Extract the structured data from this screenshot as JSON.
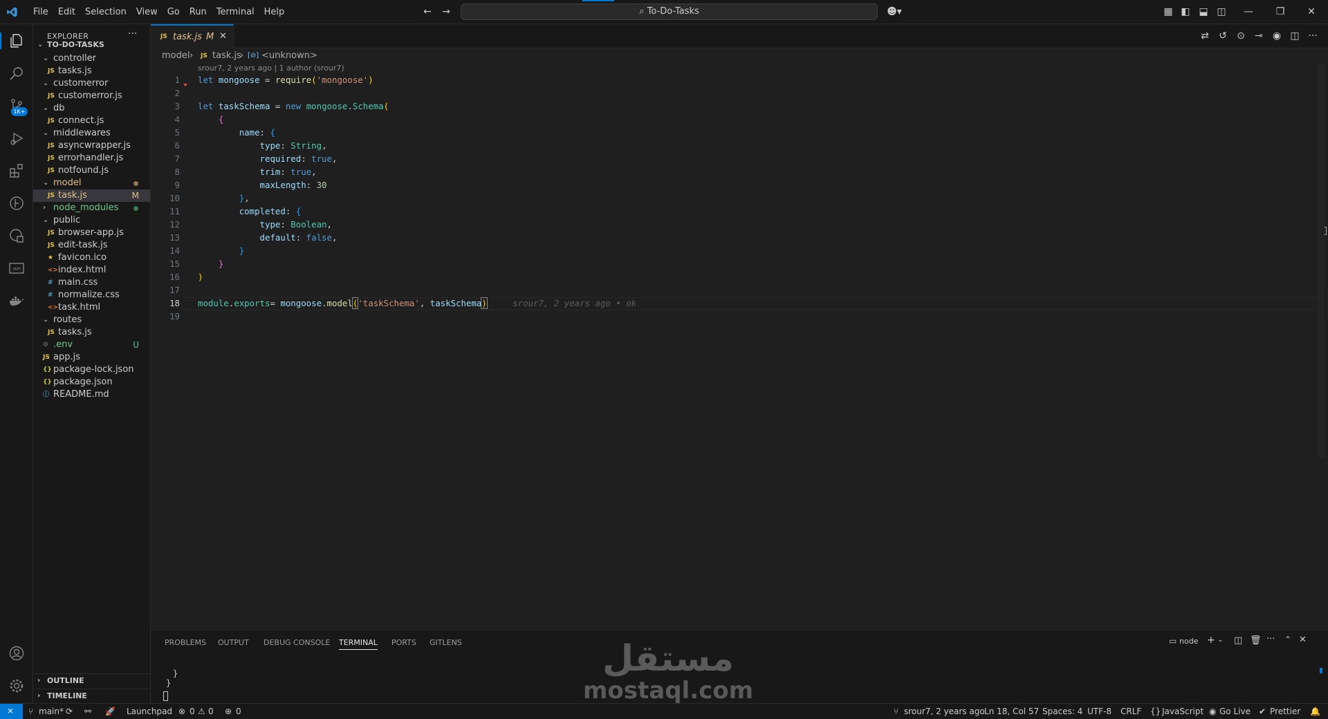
{
  "menu": [
    "File",
    "Edit",
    "Selection",
    "View",
    "Go",
    "Run",
    "Terminal",
    "Help"
  ],
  "search": {
    "text": "To-Do-Tasks"
  },
  "sidebar": {
    "title": "EXPLORER",
    "root": "TO-DO-TASKS",
    "items": [
      {
        "label": "controller",
        "type": "folder"
      },
      {
        "label": "tasks.js",
        "type": "js"
      },
      {
        "label": "customerror",
        "type": "folder"
      },
      {
        "label": "customerror.js",
        "type": "js"
      },
      {
        "label": "db",
        "type": "folder"
      },
      {
        "label": "connect.js",
        "type": "js"
      },
      {
        "label": "middlewares",
        "type": "folder"
      },
      {
        "label": "asyncwrapper.js",
        "type": "js"
      },
      {
        "label": "errorhandler.js",
        "type": "js"
      },
      {
        "label": "notfound.js",
        "type": "js"
      },
      {
        "label": "model",
        "type": "folder"
      },
      {
        "label": "task.js",
        "type": "js",
        "badge": "M"
      },
      {
        "label": "node_modules",
        "type": "folder-closed"
      },
      {
        "label": "public",
        "type": "folder"
      },
      {
        "label": "browser-app.js",
        "type": "js"
      },
      {
        "label": "edit-task.js",
        "type": "js"
      },
      {
        "label": "favicon.ico",
        "type": "ico"
      },
      {
        "label": "index.html",
        "type": "html"
      },
      {
        "label": "main.css",
        "type": "css"
      },
      {
        "label": "normalize.css",
        "type": "css"
      },
      {
        "label": "task.html",
        "type": "html"
      },
      {
        "label": "routes",
        "type": "folder"
      },
      {
        "label": "tasks.js",
        "type": "js"
      },
      {
        "label": ".env",
        "type": "env",
        "badge": "U"
      },
      {
        "label": "app.js",
        "type": "js"
      },
      {
        "label": "package-lock.json",
        "type": "json"
      },
      {
        "label": "package.json",
        "type": "json"
      },
      {
        "label": "README.md",
        "type": "md"
      }
    ],
    "outline": "OUTLINE",
    "timeline": "TIMELINE",
    "source_control_badge": "1K+"
  },
  "tab": {
    "icon": "JS",
    "name": "task.js",
    "modified": "M"
  },
  "breadcrumb": {
    "folder": "model",
    "file": "task.js",
    "symbol": "<unknown>"
  },
  "blame_header": "srour7, 2 years ago | 1 author (srour7)",
  "inline_blame": "srour7, 2 years ago • ok",
  "code_lines": [
    "1",
    "2",
    "3",
    "4",
    "5",
    "6",
    "7",
    "8",
    "9",
    "10",
    "11",
    "12",
    "13",
    "14",
    "15",
    "16",
    "17",
    "18",
    "19"
  ],
  "panel": {
    "tabs": [
      "PROBLEMS",
      "OUTPUT",
      "DEBUG CONSOLE",
      "TERMINAL",
      "PORTS",
      "GITLENS"
    ],
    "terminal_name": "node",
    "terminal_lines": [
      "}",
      "}"
    ]
  },
  "watermark": {
    "arabic": "مستقل",
    "latin": "mostaql.com"
  },
  "status": {
    "branch": "main*",
    "launchpad": "Launchpad",
    "errors": "0",
    "warnings": "0",
    "ports": "0",
    "blame": "srour7, 2 years ago",
    "position": "Ln 18, Col 57",
    "spaces": "Spaces: 4",
    "encoding": "UTF-8",
    "eol": "CRLF",
    "language": "JavaScript",
    "golive": "Go Live",
    "prettier": "Prettier"
  }
}
